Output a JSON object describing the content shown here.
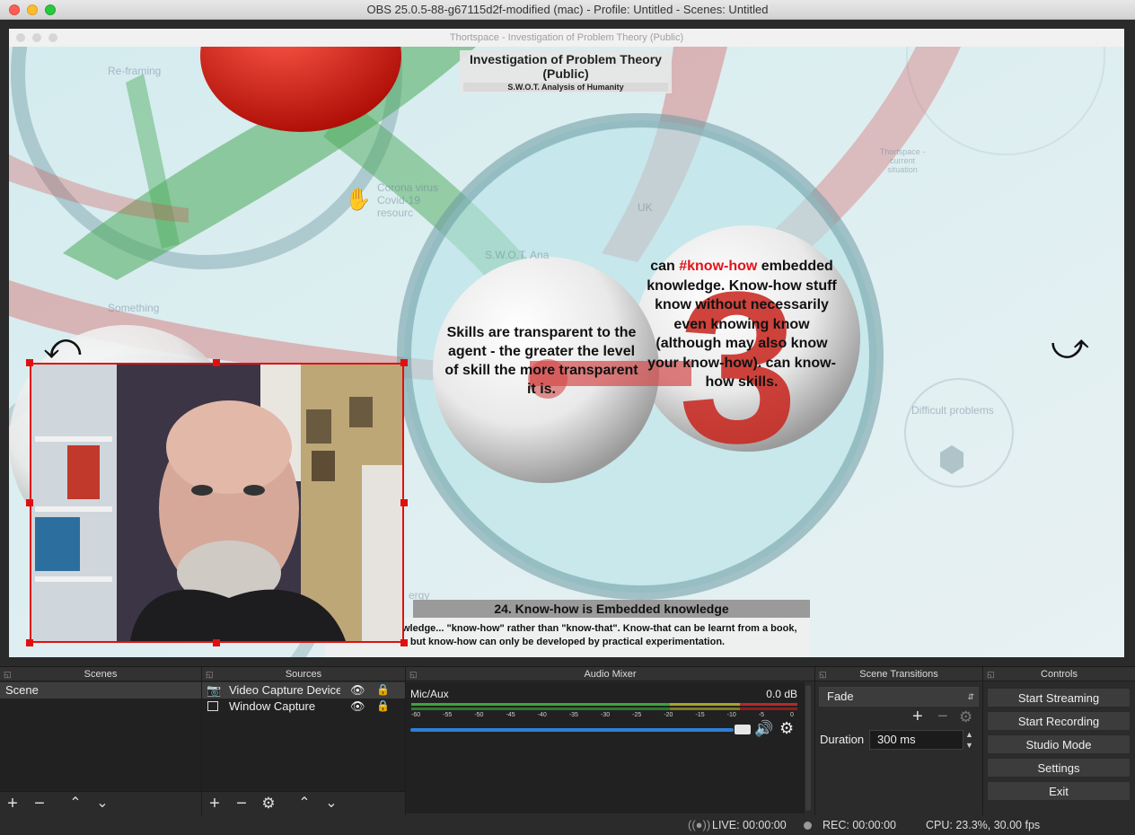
{
  "app": {
    "title": "OBS 25.0.5-88-g67115d2f-modified (mac) - Profile: Untitled - Scenes: Untitled"
  },
  "captured_window": {
    "title": "Thortspace - Investigation of Problem Theory (Public)",
    "heading_title": "Investigation of Problem Theory (Public)",
    "heading_subtitle": "S.W.O.T. Analysis of Humanity",
    "left_sphere_text": "Skills are transparent to the agent - the greater the level of skill the more transparent it is.",
    "right_sphere_prefix": "can ",
    "right_sphere_hashtag": "#know-how",
    "right_sphere_rest": "embedded knowledge. Know-how stuff know without necessarily even knowing know (although may also know your know-how). can know-how skills.",
    "faint_labels": {
      "reframing": "Re-framing",
      "corona": "Corona virus Covid-19 resourc",
      "uk": "UK",
      "swot": "S.W.O.T. Ana",
      "thortspace": "Thortspace - current situation",
      "difficult": "Difficult problems",
      "left_mid": "Something",
      "energy": "ergy"
    },
    "caption_title": "24. Know-how is Embedded knowledge",
    "caption_body": "...sparent knowledge... \"know-how\" rather than \"know-that\". Know-that can be learnt from a book, but know-how can only be developed by practical experimentation."
  },
  "docks": {
    "scenes": {
      "header": "Scenes",
      "items": [
        "Scene"
      ]
    },
    "sources": {
      "header": "Sources",
      "items": [
        {
          "name": "Video Capture Device",
          "icon": "camera-icon"
        },
        {
          "name": "Window Capture",
          "icon": "window-icon"
        }
      ]
    },
    "audio_mixer": {
      "header": "Audio Mixer",
      "channel_name": "Mic/Aux",
      "channel_db": "0.0 dB",
      "scale": [
        "-60",
        "-55",
        "-50",
        "-45",
        "-40",
        "-35",
        "-30",
        "-25",
        "-20",
        "-15",
        "-10",
        "-5",
        "0"
      ],
      "volume_fraction": 1.0
    },
    "scene_transitions": {
      "header": "Scene Transitions",
      "transition": "Fade",
      "duration_label": "Duration",
      "duration_value": "300 ms"
    },
    "controls": {
      "header": "Controls",
      "start_streaming": "Start Streaming",
      "start_recording": "Start Recording",
      "studio_mode": "Studio Mode",
      "settings": "Settings",
      "exit": "Exit"
    }
  },
  "status": {
    "live": "LIVE: 00:00:00",
    "rec": "REC: 00:00:00",
    "cpu": "CPU: 23.3%, 30.00 fps"
  },
  "colors": {
    "selection_red": "#e01010",
    "hashtag_red": "#e0141b",
    "meter_green": "#3aa63a",
    "meter_yellow": "#a8a528",
    "meter_red": "#b82828",
    "slider_blue": "#2f7fd6"
  }
}
